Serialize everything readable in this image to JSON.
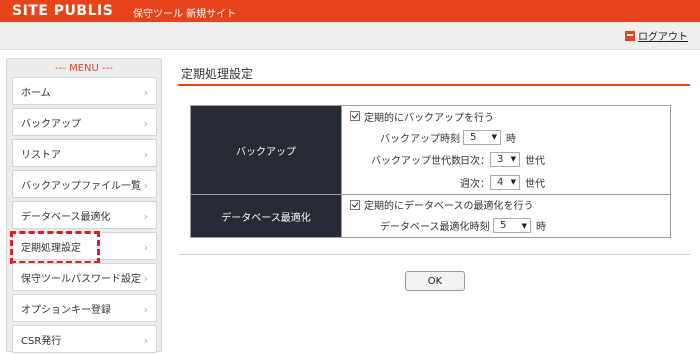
{
  "header": {
    "logo": "SITE PUBLIS",
    "subtitle": "保守ツール 新規サイト",
    "logout_label": "ログアウト"
  },
  "sidebar": {
    "title": "--- MENU ---",
    "items": [
      {
        "label": "ホーム"
      },
      {
        "label": "バックアップ"
      },
      {
        "label": "リストア"
      },
      {
        "label": "バックアップファイル一覧"
      },
      {
        "label": "データベース最適化"
      },
      {
        "label": "定期処理設定"
      },
      {
        "label": "保守ツールパスワード設定"
      },
      {
        "label": "オプションキー登録"
      },
      {
        "label": "CSR発行"
      }
    ],
    "active_index": 5
  },
  "main": {
    "title": "定期処理設定",
    "backup": {
      "label": "バックアップ",
      "checkbox_label": "定期的にバックアップを行う",
      "time_label": "バックアップ時刻",
      "time_value": "5",
      "time_unit": "時",
      "generations_label": "バックアップ世代数",
      "daily_label": "日次：",
      "daily_value": "3",
      "weekly_label": "週次：",
      "weekly_value": "4",
      "generation_unit": "世代"
    },
    "db": {
      "label": "データベース最適化",
      "checkbox_label": "定期的にデータベースの最適化を行う",
      "time_label": "データベース最適化時刻",
      "time_value": "5",
      "time_unit": "時"
    },
    "ok_label": "OK"
  },
  "colors": {
    "accent": "#e8441b",
    "label_bg": "#272b36",
    "highlight_dash": "#e02020"
  }
}
